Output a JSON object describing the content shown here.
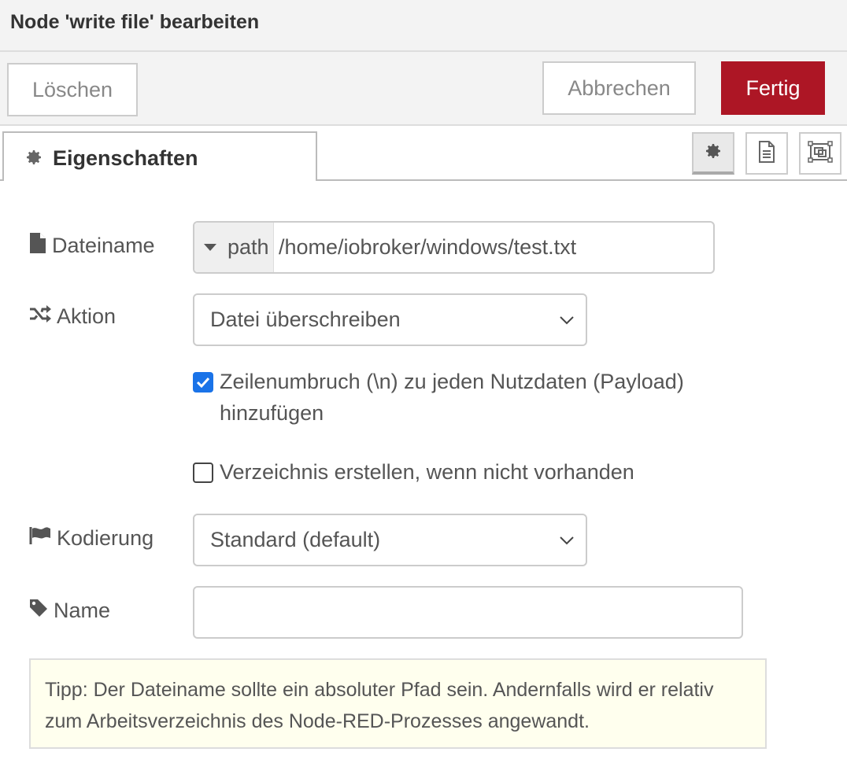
{
  "dialog": {
    "title": "Node 'write file' bearbeiten"
  },
  "toolbar": {
    "delete_label": "Löschen",
    "cancel_label": "Abbrechen",
    "done_label": "Fertig",
    "done_color": "#ad1625"
  },
  "tabs": {
    "properties_label": "Eigenschaften",
    "icon_buttons": [
      "gear-icon",
      "document-icon",
      "frame-icon"
    ]
  },
  "form": {
    "filename": {
      "label": "Dateiname",
      "type_selector": "path",
      "value": "/home/iobroker/windows/test.txt"
    },
    "action": {
      "label": "Aktion",
      "selected": "Datei überschreiben"
    },
    "append_newline": {
      "checked": true,
      "label": "Zeilenumbruch (\\n) zu jeden Nutzdaten (Payload) hinzufügen"
    },
    "create_dir": {
      "checked": false,
      "label": "Verzeichnis erstellen, wenn nicht vorhanden"
    },
    "encoding": {
      "label": "Kodierung",
      "selected": "Standard (default)"
    },
    "name": {
      "label": "Name",
      "value": ""
    }
  },
  "tip": {
    "text": "Tipp: Der Dateiname sollte ein absoluter Pfad sein. Andernfalls wird er relativ zum Arbeitsverzeichnis des Node-RED-Prozesses angewandt."
  }
}
